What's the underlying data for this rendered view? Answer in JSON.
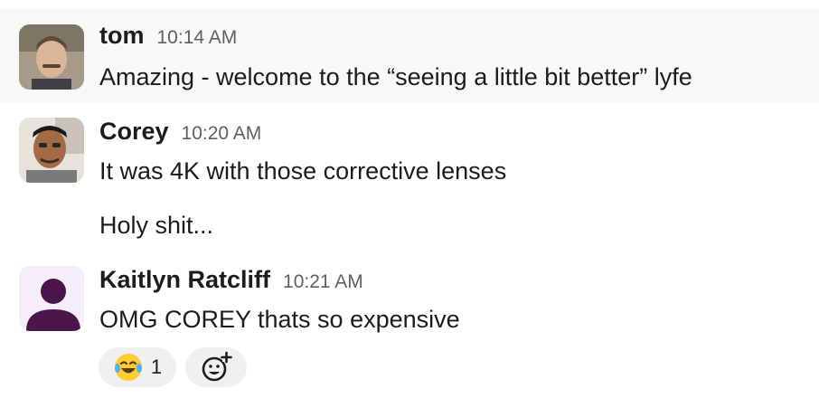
{
  "messages": [
    {
      "author": "tom",
      "time": "10:14 AM",
      "lines": [
        "Amazing - welcome to the “seeing a little bit better” lyfe"
      ]
    },
    {
      "author": "Corey",
      "time": "10:20 AM",
      "lines": [
        "It was 4K with those corrective lenses",
        "Holy shit..."
      ]
    },
    {
      "author": "Kaitlyn Ratcliff",
      "time": "10:21 AM",
      "lines": [
        "OMG COREY thats so expensive"
      ],
      "reactions": [
        {
          "emoji": "joy-emoji",
          "count": "1"
        }
      ],
      "add_reaction_icon": "add-reaction-icon"
    }
  ],
  "colors": {
    "avatar_default_bg": "#ede7f6",
    "avatar_default_fg": "#4a154b",
    "hover_bg": "#f8f8f8",
    "timestamp": "#616061"
  }
}
